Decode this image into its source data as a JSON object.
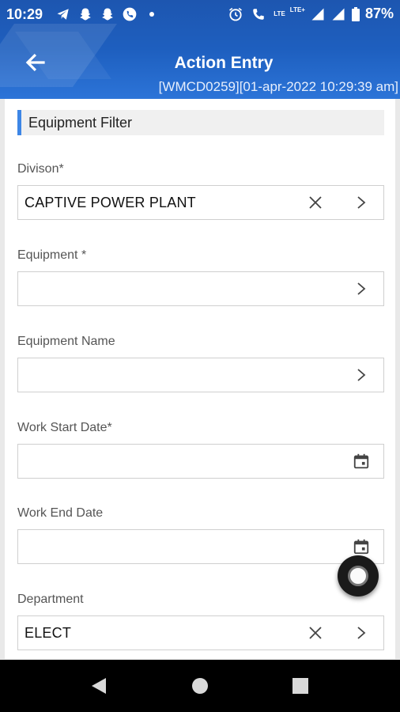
{
  "status_bar": {
    "time": "10:29",
    "battery": "87%",
    "network_label_1": "LTE",
    "network_label_2": "LTE+"
  },
  "app_bar": {
    "title": "Action Entry",
    "subtitle": "[WMCD0259][01-apr-2022 10:29:39 am]"
  },
  "section": {
    "title": "Equipment Filter"
  },
  "fields": {
    "division": {
      "label": "Divison*",
      "value": "CAPTIVE POWER PLANT"
    },
    "equipment": {
      "label": "Equipment *",
      "value": ""
    },
    "equipment_name": {
      "label": "Equipment Name",
      "value": ""
    },
    "work_start_date": {
      "label": "Work Start Date*",
      "value": ""
    },
    "work_end_date": {
      "label": "Work End Date",
      "value": ""
    },
    "department": {
      "label": "Department",
      "value": "ELECT"
    }
  },
  "colors": {
    "header": "#1e5fbf",
    "accent": "#3d86e6",
    "nav_bar": "#000000"
  },
  "icons": {
    "back": "arrow-left-icon",
    "clear": "close-icon",
    "chevron": "chevron-right-icon",
    "calendar": "calendar-icon"
  }
}
